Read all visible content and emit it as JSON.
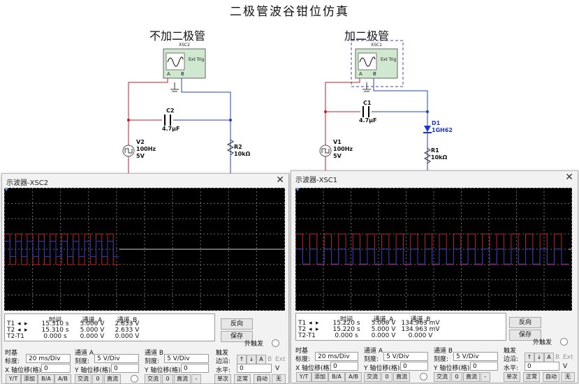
{
  "page_title": "二极管波谷钳位仿真",
  "left_section_title": "不加二极管",
  "right_section_title": "加二极管",
  "components": {
    "xsc2": "XSC2",
    "xsc1": "XSC1",
    "c2_name": "C2",
    "c2_value": "4.7µF",
    "c1_name": "C1",
    "c1_value": "4.7µF",
    "v2_name": "V2",
    "v2_freq": "100Hz",
    "v2_amp": "5V",
    "v1_name": "V1",
    "v1_freq": "100Hz",
    "v1_amp": "5V",
    "r2_name": "R2",
    "r2_value": "10kΩ",
    "r1_name": "R1",
    "r1_value": "10kΩ",
    "d1_name": "D1",
    "d1_value": "1GH62",
    "ext_trig": "Ext Trig",
    "pin_a": "A",
    "pin_b": "B"
  },
  "colors": {
    "channel_a": "#c0202a",
    "channel_b": "#2040c0",
    "screen_bg": "#000000",
    "grid": "#6e6e6e",
    "diode": "#1a33d6"
  },
  "scope_left": {
    "title": "示波器-XSC2",
    "readout": {
      "headers": [
        "时间",
        "通道_A",
        "通道_B"
      ],
      "rows": [
        {
          "label": "T1",
          "time": "15.310 s",
          "a": "5.000 V",
          "b": "2.633 V"
        },
        {
          "label": "T2",
          "time": "15.310 s",
          "a": "5.000 V",
          "b": "2.633 V"
        },
        {
          "label": "T2-T1",
          "time": "0.000 s",
          "a": "0.000 V",
          "b": "0.000 V"
        }
      ]
    },
    "reverse_label": "反向",
    "save_label": "保存",
    "ext_trigger_label": "外触发",
    "timebase": {
      "group": "时基",
      "scale_label": "标度:",
      "scale": "20 ms/Div",
      "xpos_label": "X 轴位移(格):",
      "xpos": "0",
      "btn_yt": "Y/T",
      "btn_add": "添加",
      "btn_ba": "B/A",
      "btn_ab": "A/B"
    },
    "channel_a": {
      "group": "通道 A",
      "scale_label": "刻度:",
      "scale": "5  V/Div",
      "ypos_label": "Y 轴位移(格):",
      "ypos": "0",
      "ac": "交流",
      "zero": "0",
      "dc": "直流"
    },
    "channel_b": {
      "group": "通道 B",
      "scale_label": "刻度:",
      "scale": "5  V/Div",
      "ypos_label": "Y 轴位移(格):",
      "ypos": "0",
      "ac": "交流",
      "zero": "0",
      "dc": "直流",
      "minus": "-"
    },
    "trigger": {
      "group": "触发",
      "edge_label": "边沿:",
      "level_label": "水平:",
      "level": "0",
      "unit": "V",
      "btn_a": "A",
      "btn_b": "B",
      "btn_ext": "Ext",
      "single": "单次",
      "normal": "正常",
      "auto": "自动",
      "none": "无"
    },
    "wave": {
      "cycles": 10,
      "period_fraction": 0.0409,
      "start_fraction": 0.0,
      "high_a": 0.5,
      "low_a": -0.5,
      "high_b": 0.26,
      "low_b": -0.24
    }
  },
  "scope_right": {
    "title": "示波器-XSC1",
    "readout": {
      "headers": [
        "时间",
        "通道_A",
        "通道_B"
      ],
      "rows": [
        {
          "label": "T1",
          "time": "15.220 s",
          "a": "5.000 V",
          "b": "134.963 mV"
        },
        {
          "label": "T2",
          "time": "15.220 s",
          "a": "5.000 V",
          "b": "134.963 mV"
        },
        {
          "label": "T2-T1",
          "time": "0.000 s",
          "a": "0.000 V",
          "b": "0.000 V"
        }
      ]
    },
    "reverse_label": "反向",
    "save_label": "保存",
    "ext_trigger_label": "外触发",
    "timebase": {
      "group": "时基",
      "scale_label": "标度:",
      "scale": "20 ms/Div",
      "xpos_label": "X 轴位移(格):",
      "xpos": "0",
      "btn_yt": "Y/T",
      "btn_add": "添加",
      "btn_ba": "B/A",
      "btn_ab": "A/B"
    },
    "channel_a": {
      "group": "通道 A",
      "scale_label": "刻度:",
      "scale": "5  V/Div",
      "ypos_label": "Y 轴位移(格):",
      "ypos": "0",
      "ac": "交流",
      "zero": "0",
      "dc": "直流"
    },
    "channel_b": {
      "group": "通道 B",
      "scale_label": "刻度:",
      "scale": "5  V/Div",
      "ypos_label": "Y 轴位移(格):",
      "ypos": "0",
      "ac": "交流",
      "zero": "0",
      "dc": "直流",
      "minus": "-"
    },
    "trigger": {
      "group": "触发",
      "edge_label": "边沿:",
      "level_label": "水平:",
      "level": "0",
      "unit": "V",
      "btn_a": "A",
      "btn_b": "B",
      "btn_ext": "Ext",
      "single": "单次",
      "normal": "正常",
      "auto": "自动",
      "none": "无"
    },
    "wave": {
      "cycles": 19,
      "period_fraction": 0.052,
      "start_fraction": 0.0,
      "high_a": 0.5,
      "low_a": -0.5,
      "high_b": 0.01,
      "low_b": -0.48
    }
  }
}
